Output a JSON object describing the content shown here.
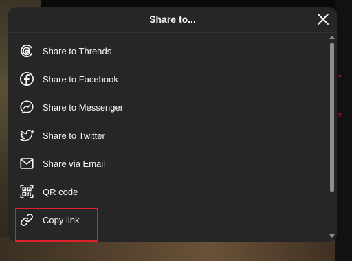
{
  "dialog": {
    "title": "Share to...",
    "items": [
      {
        "label": "Share to Threads",
        "icon": "threads-icon"
      },
      {
        "label": "Share to Facebook",
        "icon": "facebook-icon"
      },
      {
        "label": "Share to Messenger",
        "icon": "messenger-icon"
      },
      {
        "label": "Share to Twitter",
        "icon": "twitter-icon"
      },
      {
        "label": "Share via Email",
        "icon": "email-icon"
      },
      {
        "label": "QR code",
        "icon": "qr-code-icon"
      },
      {
        "label": "Copy link",
        "icon": "link-icon"
      }
    ]
  },
  "colors": {
    "dialog_bg": "#262626",
    "text": "#f5f5f5",
    "highlight": "#e0212b",
    "background_accent": "#b3264d"
  }
}
